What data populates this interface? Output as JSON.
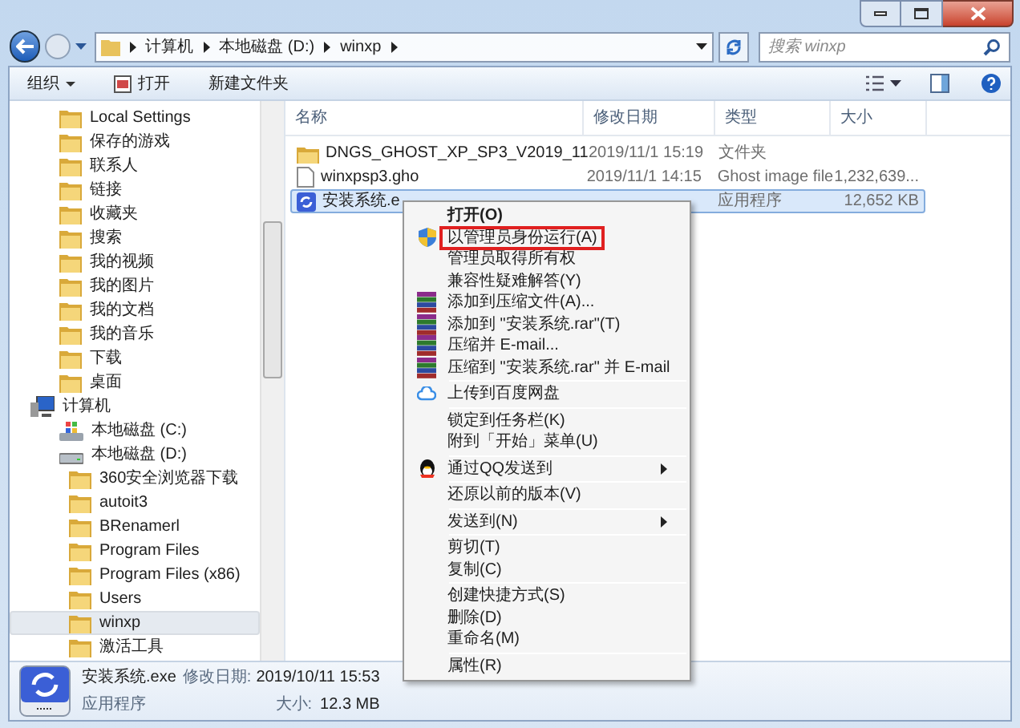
{
  "address": {
    "crumbs": [
      "计算机",
      "本地磁盘 (D:)",
      "winxp"
    ]
  },
  "search": {
    "placeholder": "搜索 winxp"
  },
  "toolbar": {
    "buttons": [
      {
        "label": "组织",
        "kind": "dropdown"
      },
      {
        "label": "打开",
        "kind": "open"
      },
      {
        "label": "新建文件夹",
        "kind": "plain"
      }
    ]
  },
  "sidebar": {
    "items": [
      {
        "label": "Local Settings",
        "selected": false
      },
      {
        "label": "保存的游戏",
        "selected": false
      },
      {
        "label": "联系人",
        "selected": false
      },
      {
        "label": "链接",
        "selected": false
      },
      {
        "label": "收藏夹",
        "selected": false
      },
      {
        "label": "搜索",
        "selected": false
      },
      {
        "label": "我的视频",
        "selected": false
      },
      {
        "label": "我的图片",
        "selected": false
      },
      {
        "label": "我的文档",
        "selected": false
      },
      {
        "label": "我的音乐",
        "selected": false
      },
      {
        "label": "下载",
        "selected": false
      },
      {
        "label": "桌面",
        "selected": false
      }
    ],
    "computer": {
      "label": "计算机",
      "selected": false,
      "children": [
        {
          "label": "本地磁盘 (C:)",
          "kind": "system-drive",
          "selected": false
        },
        {
          "label": "本地磁盘 (D:)",
          "kind": "drive",
          "selected": false,
          "children": [
            {
              "label": "360安全浏览器下载",
              "selected": false
            },
            {
              "label": "autoit3",
              "selected": false
            },
            {
              "label": "BRenamerl",
              "selected": false
            },
            {
              "label": "Program Files",
              "selected": false
            },
            {
              "label": "Program Files (x86)",
              "selected": false
            },
            {
              "label": "Users",
              "selected": false
            },
            {
              "label": "winxp",
              "selected": true
            },
            {
              "label": "激活工具",
              "selected": false
            }
          ]
        }
      ]
    }
  },
  "table": {
    "columns": [
      "名称",
      "修改日期",
      "类型",
      "大小"
    ],
    "rows": [
      {
        "kind": "folder",
        "selected": false,
        "cells": [
          "DNGS_GHOST_XP_SP3_V2019_11",
          "2019/11/1 15:19",
          "文件夹",
          ""
        ]
      },
      {
        "kind": "file",
        "selected": false,
        "cells": [
          "winxpsp3.gho",
          "2019/11/1 14:15",
          "Ghost image file",
          "1,232,639..."
        ]
      },
      {
        "kind": "exe",
        "selected": true,
        "cells": [
          "安装系统.e",
          "",
          "应用程序",
          "12,652 KB"
        ]
      }
    ]
  },
  "context_menu": {
    "groups": [
      [
        {
          "label": "打开(O)",
          "kind": "plain",
          "default": true,
          "highlighted": false,
          "submenu": false
        },
        {
          "label": "以管理员身份运行(A)",
          "kind": "shield",
          "default": false,
          "highlighted": true,
          "submenu": false
        },
        {
          "label": "管理员取得所有权",
          "kind": "plain",
          "default": false,
          "highlighted": false,
          "submenu": false
        },
        {
          "label": "兼容性疑难解答(Y)",
          "kind": "plain",
          "default": false,
          "highlighted": false,
          "submenu": false
        },
        {
          "label": "添加到压缩文件(A)...",
          "kind": "rar",
          "default": false,
          "highlighted": false,
          "submenu": false
        },
        {
          "label": "添加到 \"安装系统.rar\"(T)",
          "kind": "rar",
          "default": false,
          "highlighted": false,
          "submenu": false
        },
        {
          "label": "压缩并 E-mail...",
          "kind": "rar",
          "default": false,
          "highlighted": false,
          "submenu": false
        },
        {
          "label": "压缩到 \"安装系统.rar\" 并 E-mail",
          "kind": "rar",
          "default": false,
          "highlighted": false,
          "submenu": false
        }
      ],
      [
        {
          "label": "上传到百度网盘",
          "kind": "cloud",
          "default": false,
          "highlighted": false,
          "submenu": false
        }
      ],
      [
        {
          "label": "锁定到任务栏(K)",
          "kind": "plain",
          "default": false,
          "highlighted": false,
          "submenu": false
        },
        {
          "label": "附到「开始」菜单(U)",
          "kind": "plain",
          "default": false,
          "highlighted": false,
          "submenu": false
        }
      ],
      [
        {
          "label": "通过QQ发送到",
          "kind": "qq",
          "default": false,
          "highlighted": false,
          "submenu": true
        }
      ],
      [
        {
          "label": "还原以前的版本(V)",
          "kind": "plain",
          "default": false,
          "highlighted": false,
          "submenu": false
        }
      ],
      [
        {
          "label": "发送到(N)",
          "kind": "plain",
          "default": false,
          "highlighted": false,
          "submenu": true
        }
      ],
      [
        {
          "label": "剪切(T)",
          "kind": "plain",
          "default": false,
          "highlighted": false,
          "submenu": false
        },
        {
          "label": "复制(C)",
          "kind": "plain",
          "default": false,
          "highlighted": false,
          "submenu": false
        }
      ],
      [
        {
          "label": "创建快捷方式(S)",
          "kind": "plain",
          "default": false,
          "highlighted": false,
          "submenu": false
        },
        {
          "label": "删除(D)",
          "kind": "plain",
          "default": false,
          "highlighted": false,
          "submenu": false
        },
        {
          "label": "重命名(M)",
          "kind": "plain",
          "default": false,
          "highlighted": false,
          "submenu": false
        }
      ],
      [
        {
          "label": "属性(R)",
          "kind": "plain",
          "default": false,
          "highlighted": false,
          "submenu": false
        }
      ]
    ]
  },
  "details": {
    "name": "安装系统.exe",
    "date_label": "修改日期:",
    "date": "2019/10/11 15:53",
    "type": "应用程序",
    "size_label": "大小:",
    "size": "12.3 MB"
  }
}
